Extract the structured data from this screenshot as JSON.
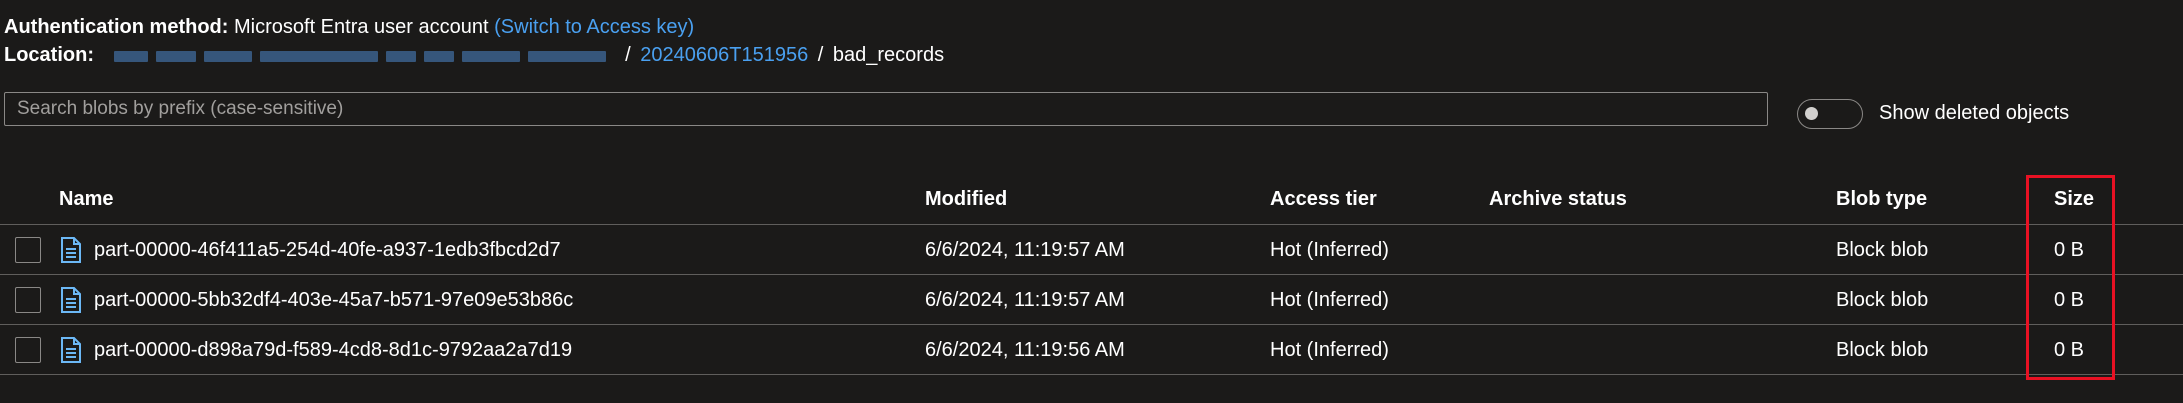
{
  "auth": {
    "label": "Authentication method:",
    "value": "Microsoft Entra user account",
    "switch_link": "(Switch to Access key)"
  },
  "location": {
    "label": "Location:",
    "folder_link": "20240606T151956",
    "current": "bad_records",
    "separator": "/"
  },
  "search": {
    "placeholder": "Search blobs by prefix (case-sensitive)",
    "value": ""
  },
  "toggle": {
    "label": "Show deleted objects",
    "on": false
  },
  "table": {
    "columns": {
      "name": "Name",
      "modified": "Modified",
      "access_tier": "Access tier",
      "archive_status": "Archive status",
      "blob_type": "Blob type",
      "size": "Size"
    },
    "rows": [
      {
        "name": "part-00000-46f411a5-254d-40fe-a937-1edb3fbcd2d7",
        "modified": "6/6/2024, 11:19:57 AM",
        "access_tier": "Hot (Inferred)",
        "archive_status": "",
        "blob_type": "Block blob",
        "size": "0 B"
      },
      {
        "name": "part-00000-5bb32df4-403e-45a7-b571-97e09e53b86c",
        "modified": "6/6/2024, 11:19:57 AM",
        "access_tier": "Hot (Inferred)",
        "archive_status": "",
        "blob_type": "Block blob",
        "size": "0 B"
      },
      {
        "name": "part-00000-d898a79d-f589-4cd8-8d1c-9792aa2a7d19",
        "modified": "6/6/2024, 11:19:56 AM",
        "access_tier": "Hot (Inferred)",
        "archive_status": "",
        "blob_type": "Block blob",
        "size": "0 B"
      }
    ]
  },
  "icons": {
    "file": "file-icon",
    "toggle_knob": "toggle-knob"
  },
  "colors": {
    "background": "#1b1a19",
    "link": "#4aa0f0",
    "highlight": "#e81123",
    "file_icon": "#6cb8f6"
  }
}
